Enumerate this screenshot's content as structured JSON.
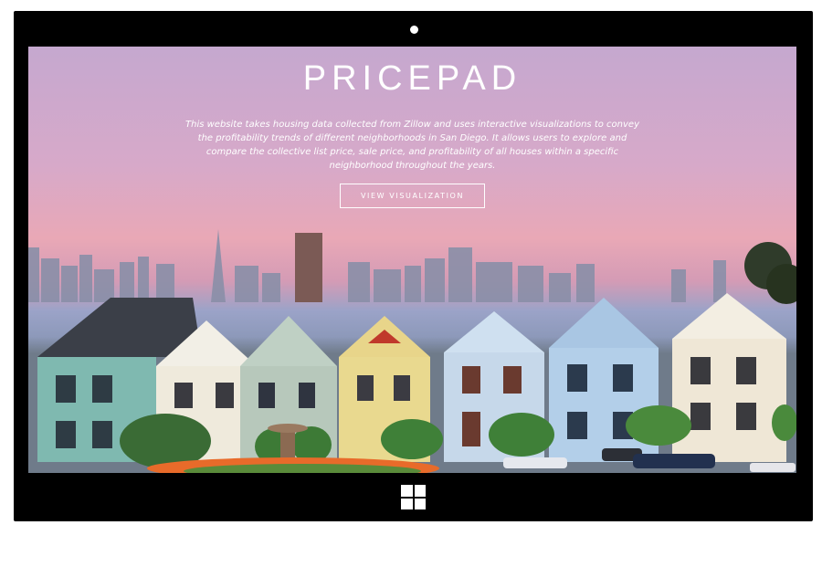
{
  "hero": {
    "title": "PRICEPAD",
    "description": "This website takes housing data collected from Zillow and uses interactive visualizations to convey the profitability trends of different neighborhoods in San Diego. It allows users to explore and compare the collective list price, sale price, and profitability of all houses within a specific neighborhood throughout the years.",
    "button_label": "VIEW VISUALIZATION"
  },
  "background_image": "painted-ladies-houses-with-city-skyline",
  "device": {
    "home_icon": "windows-logo-icon",
    "camera_icon": "camera-dot-icon"
  },
  "colors": {
    "frame": "#000000",
    "sky_top": "#c5a8cf",
    "sky_bottom": "#e9a8b6",
    "text": "#ffffff"
  }
}
